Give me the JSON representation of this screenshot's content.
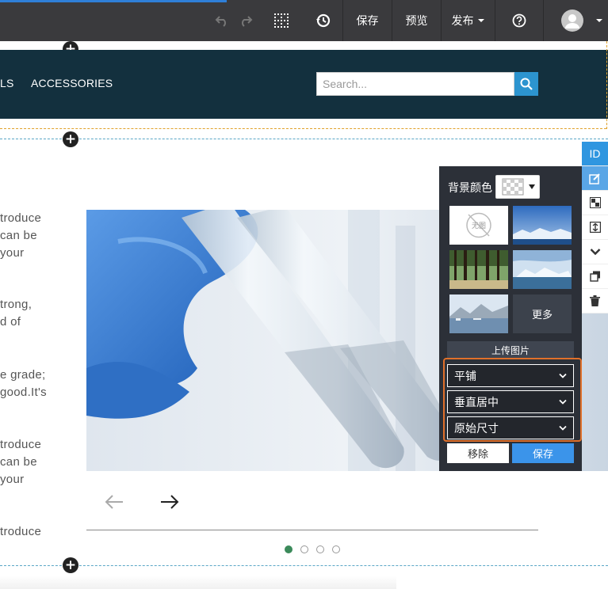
{
  "toolbar": {
    "save_label": "保存",
    "preview_label": "预览",
    "publish_label": "发布",
    "icons": [
      "undo-icon",
      "redo-icon",
      "grid-icon",
      "history-icon",
      "help-icon",
      "avatar-icon",
      "caret-down-icon"
    ]
  },
  "header": {
    "nav": [
      {
        "label": "LS"
      },
      {
        "label": "ACCESSORIES"
      }
    ],
    "search": {
      "placeholder": "Search..."
    }
  },
  "content": {
    "lines": [
      "troduce",
      " can be",
      "your",
      "trong,",
      "d of",
      "e grade;",
      "good.It's",
      "troduce",
      " can be",
      "your",
      "troduce"
    ]
  },
  "slider": {
    "dots": 4,
    "active_dot": 1
  },
  "bg_panel": {
    "title": "背景颜色",
    "none_label": "无图",
    "more_label": "更多",
    "upload_label": "上传图片",
    "repeat_value": "平铺",
    "position_value": "垂直居中",
    "size_value": "原始尺寸",
    "remove_label": "移除",
    "save_label": "保存"
  },
  "side_tools": {
    "id_label": "ID"
  },
  "colors": {
    "toolbar_bg": "#3a3a3d",
    "header_bg": "#13303e",
    "accent_blue": "#2f96e0",
    "highlight_orange": "#e0702a"
  }
}
